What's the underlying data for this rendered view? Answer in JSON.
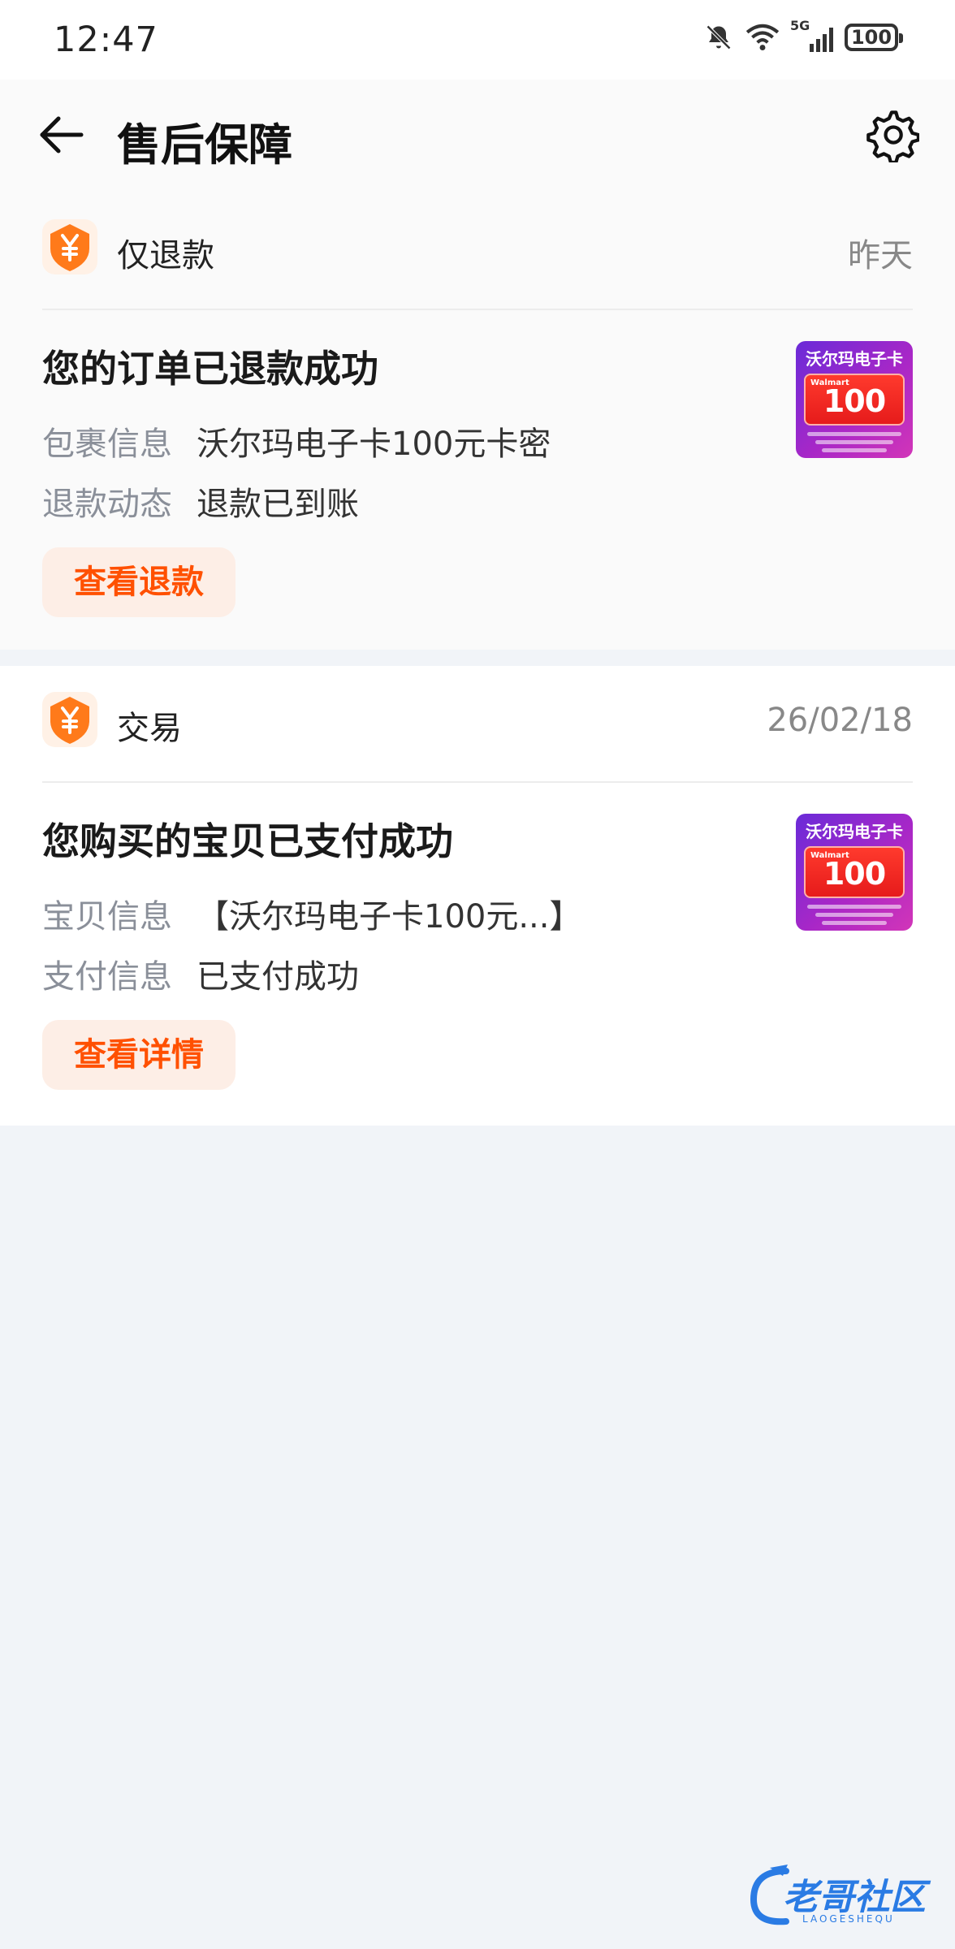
{
  "status_bar": {
    "time": "12:47",
    "network": "5G",
    "battery": "100",
    "icons": [
      "mute-bell-icon",
      "wifi-icon",
      "signal-icon",
      "battery-icon"
    ]
  },
  "header": {
    "title": "售后保障",
    "back_icon": "back-arrow-icon",
    "settings_icon": "gear-icon"
  },
  "cards": [
    {
      "type": "仅退款",
      "date": "昨天",
      "title": "您的订单已退款成功",
      "rows": [
        {
          "label": "包裹信息",
          "value": "沃尔玛电子卡100元卡密"
        },
        {
          "label": "退款动态",
          "value": "退款已到账"
        }
      ],
      "button": "查看退款",
      "thumbnail": {
        "title": "沃尔玛电子卡",
        "brand": "Walmart",
        "amount": "100"
      }
    },
    {
      "type": "交易",
      "date": "26/02/18",
      "title": "您购买的宝贝已支付成功",
      "rows": [
        {
          "label": "宝贝信息",
          "value": "【沃尔玛电子卡100元...】"
        },
        {
          "label": "支付信息",
          "value": "已支付成功"
        }
      ],
      "button": "查看详情",
      "thumbnail": {
        "title": "沃尔玛电子卡",
        "brand": "Walmart",
        "amount": "100"
      }
    }
  ],
  "watermark": {
    "text": "老哥社区",
    "sub": "LAOGESHEQU"
  },
  "colors": {
    "accent": "#ff5000",
    "badge": "#ff7a1a",
    "page_bg": "#f1f4f8"
  }
}
